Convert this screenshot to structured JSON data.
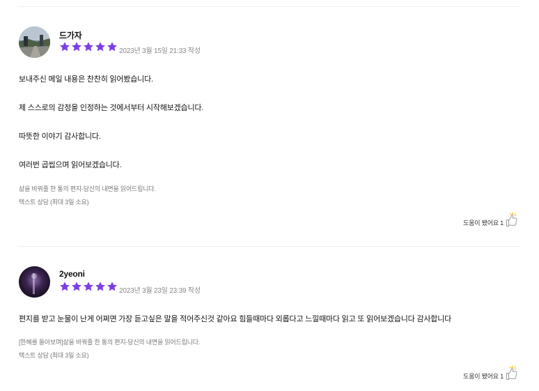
{
  "colors": {
    "star": "#7b3fe4",
    "divider": "#eeeeee",
    "date": "#888888",
    "meta": "#777777"
  },
  "reviews": [
    {
      "author": "드가자",
      "rating": 5,
      "date": "2023년 3월 15일 21:33 작성",
      "paragraphs": [
        "보내주신 메일 내용은 찬찬히 읽어봤습니다.",
        "제 스스로의 감정을 인정하는 것에서부터 시작해보겠습니다.",
        "따뜻한 이야기 감사합니다.",
        "여러번 곱씹으며 읽어보겠습니다."
      ],
      "product": "삶을 바꿔줄 한 통의 편지-당신의 내면을 읽어드립니다.",
      "option": "텍스트 상담 (최대 3일 소요)",
      "helpful_label": "도움이 됐어요 1"
    },
    {
      "author": "2yeoni",
      "rating": 5,
      "date": "2023년 3월 23일 23:39 작성",
      "paragraphs": [
        "편지를 받고 눈물이 난게 어쩌면 가장 듣고싶은 말을 적어주신것 같아요 힘들때마다 외롭다고 느낄때마다 읽고 또 읽어보겠습니다  감사합니다"
      ],
      "product": "[한혜를 돌아보며]삶을 바꿔줄 한 통의 편지-당신의 내면을 읽어드립니다.",
      "option": "텍스트 상담 (최대 3일 소요)",
      "helpful_label": "도움이 됐어요 1"
    }
  ]
}
